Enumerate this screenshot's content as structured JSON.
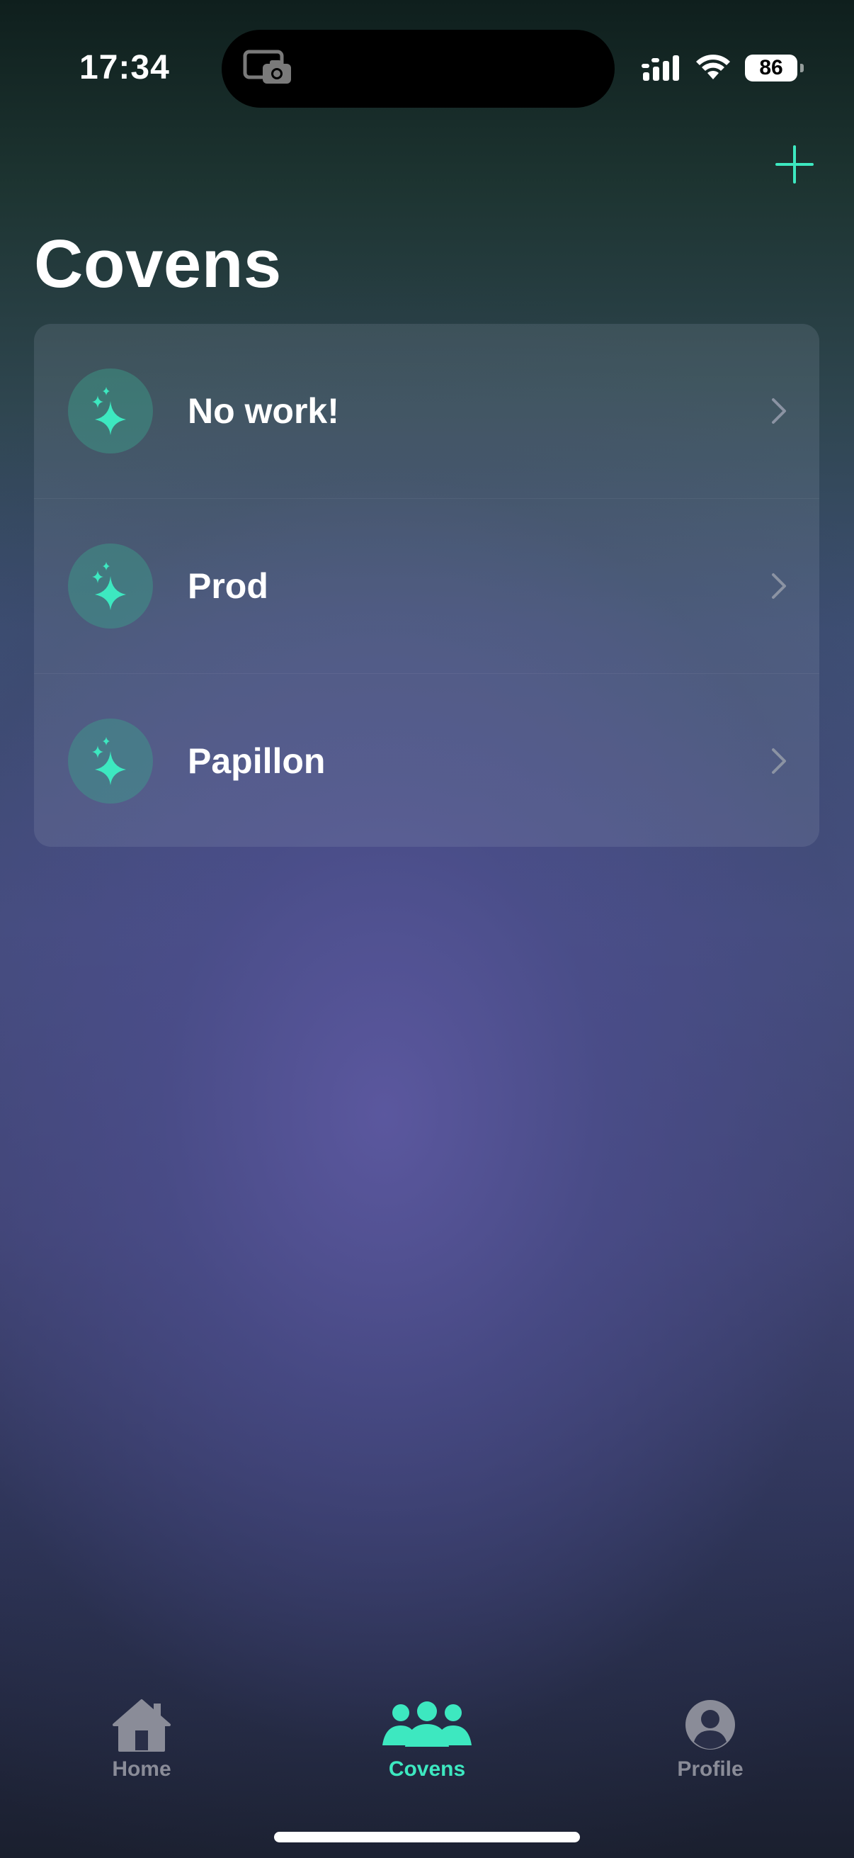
{
  "status_bar": {
    "time": "17:34",
    "battery_level": "86",
    "icons": [
      "camera-icon",
      "signal-icon",
      "wifi-icon",
      "battery-icon"
    ]
  },
  "header": {
    "title": "Covens",
    "add_icon": "plus-icon"
  },
  "covens": [
    {
      "name": "No work!",
      "icon": "sparkles-icon"
    },
    {
      "name": "Prod",
      "icon": "sparkles-icon"
    },
    {
      "name": "Papillon",
      "icon": "sparkles-icon"
    }
  ],
  "tab_bar": {
    "tabs": [
      {
        "label": "Home",
        "icon": "house-icon",
        "active": false
      },
      {
        "label": "Covens",
        "icon": "people-icon",
        "active": true
      },
      {
        "label": "Profile",
        "icon": "person-circle-icon",
        "active": false
      }
    ]
  },
  "colors": {
    "accent": "#3de8c0",
    "inactive_tab": "#8a8c98",
    "avatar_bg": "#3a8a80"
  }
}
